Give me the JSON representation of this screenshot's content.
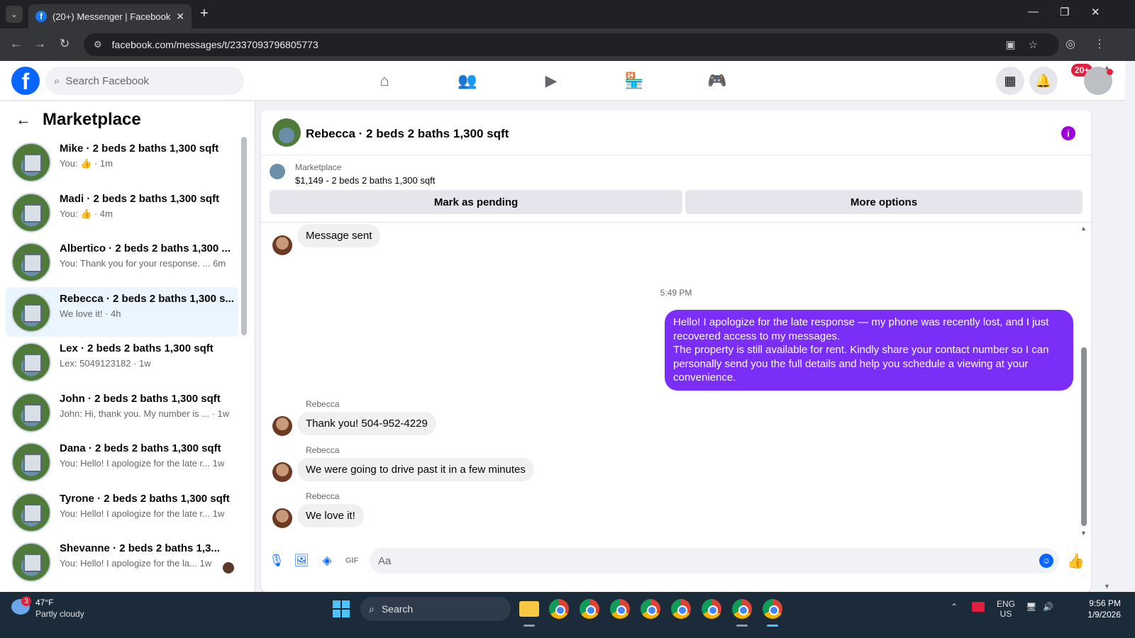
{
  "browser": {
    "tab_title": "(20+) Messenger | Facebook",
    "url": "facebook.com/messages/t/2337093796805773"
  },
  "fb_header": {
    "search_placeholder": "Search Facebook",
    "notif_badge": "20+"
  },
  "sidebar": {
    "title": "Marketplace",
    "conversations": [
      {
        "name": "Mike · 2 beds 2 baths 1,300 sqft",
        "sub": "You: 👍 · 1m"
      },
      {
        "name": "Madi · 2 beds 2 baths 1,300 sqft",
        "sub": "You: 👍 · 4m"
      },
      {
        "name": "Albertico · 2 beds 2 baths 1,300 ...",
        "sub": "You: Thank you for your response. ...  6m"
      },
      {
        "name": "Rebecca · 2 beds 2 baths 1,300 s...",
        "sub": "We love it! · 4h"
      },
      {
        "name": "Lex · 2 beds 2 baths 1,300 sqft",
        "sub": "Lex: 5049123182 · 1w"
      },
      {
        "name": "John · 2 beds 2 baths 1,300 sqft",
        "sub": "John: Hi, thank you. My number is ... · 1w"
      },
      {
        "name": "Dana · 2 beds 2 baths 1,300 sqft",
        "sub": "You: Hello! I apologize for the late r...  1w"
      },
      {
        "name": "Tyrone · 2 beds 2 baths 1,300 sqft",
        "sub": "You: Hello! I apologize for the late r...  1w"
      },
      {
        "name": "Shevanne · 2 beds 2 baths 1,3...",
        "sub": "You: Hello! I apologize for the la...  1w"
      }
    ]
  },
  "chat": {
    "title": "Rebecca · 2 beds 2 baths 1,300 sqft",
    "marketplace_label": "Marketplace",
    "listing": "$1,149 - 2 beds 2 baths 1,300 sqft",
    "mark_pending": "Mark as pending",
    "more_options": "More options",
    "msg_sent": "Message sent",
    "timestamp": "5:49 PM",
    "outgoing_line1": "Hello! I apologize for the late response — my phone was recently lost, and I just recovered access to my messages.",
    "outgoing_line2": "The property is still available for rent. Kindly share your contact number so I can personally send you the full details and help you schedule a viewing at your convenience.",
    "sender": "Rebecca",
    "msg1": "Thank you! 504-952-4229",
    "msg2": "We were going to drive past it in a few minutes",
    "msg3": "We love it!",
    "composer_placeholder": "Aa"
  },
  "taskbar": {
    "temp": "47°F",
    "weather": "Partly cloudy",
    "weather_badge": "3",
    "search": "Search",
    "lang1": "ENG",
    "lang2": "US",
    "time": "9:56 PM",
    "date": "1/9/2026"
  },
  "colors": {
    "fb_blue": "#0866ff",
    "outgoing_bubble": "#7a2ef7",
    "active_conv": "#ebf5ff"
  }
}
